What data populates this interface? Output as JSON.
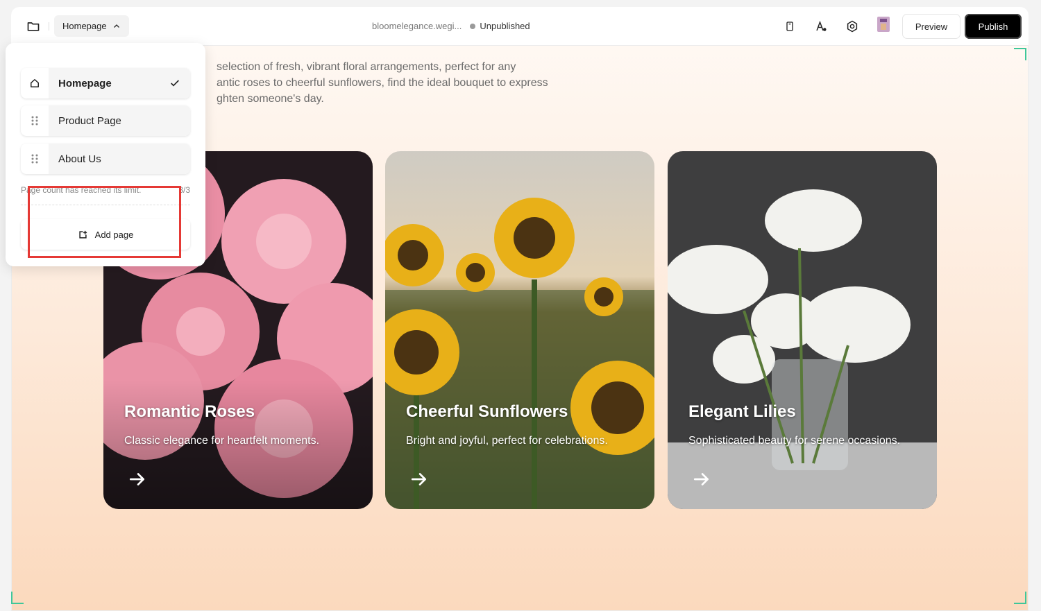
{
  "topbar": {
    "page_selector": "Homepage",
    "site_url": "bloomelegance.wegi...",
    "status": "Unpublished",
    "preview_label": "Preview",
    "publish_label": "Publish"
  },
  "intro_lines": [
    "selection of fresh, vibrant floral arrangements, perfect for any",
    "antic roses to cheerful sunflowers, find the ideal bouquet to express",
    "ghten someone's day."
  ],
  "cards": [
    {
      "title": "Romantic Roses",
      "description": "Classic elegance for heartfelt moments."
    },
    {
      "title": "Cheerful Sunflowers",
      "description": "Bright and joyful, perfect for celebrations."
    },
    {
      "title": "Elegant Lilies",
      "description": "Sophisticated beauty for serene occasions."
    }
  ],
  "pages_menu": {
    "items": [
      {
        "label": "Homepage",
        "icon": "home-icon",
        "active": true
      },
      {
        "label": "Product Page",
        "icon": "drag-handle-icon",
        "active": false
      },
      {
        "label": "About Us",
        "icon": "drag-handle-icon",
        "active": false
      }
    ],
    "limit_text": "Page count has reached its limit.",
    "limit_count": "3/3",
    "add_page_label": "Add page"
  },
  "colors": {
    "accent_corner": "#3ec79a",
    "highlight": "#e53935",
    "publish_bg": "#000000"
  }
}
